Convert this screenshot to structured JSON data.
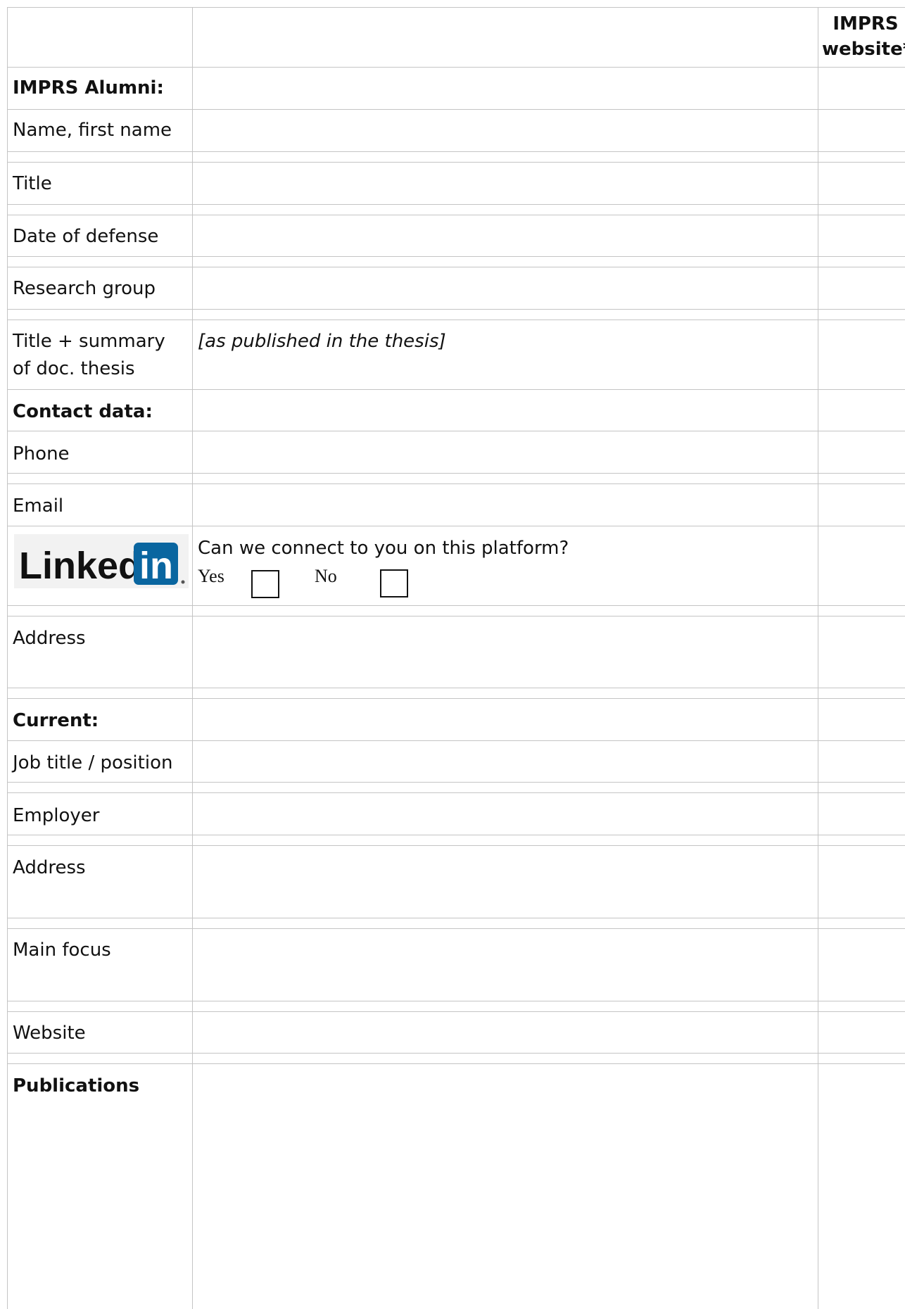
{
  "header": {
    "col3_title": [
      "IMPRS",
      "website*"
    ]
  },
  "rows": {
    "imprs_alumni": "IMPRS Alumni:",
    "name": "Name, first name",
    "title": "Title",
    "date_of_defense": "Date of defense",
    "research_group": "Research group",
    "thesis_label_1": "Title + summary",
    "thesis_label_2": "of doc. thesis",
    "thesis_hint": "[as published in the thesis]",
    "contact_data": "Contact data:",
    "phone": "Phone",
    "email": "Email",
    "linkedin_question": "Can we connect to you on this platform?",
    "yes": "Yes",
    "no": "No",
    "address": "Address",
    "current": "Current:",
    "job_title": "Job title / position",
    "employer": "Employer",
    "address2": "Address",
    "main_focus": "Main focus",
    "website": "Website",
    "publications": "Publications"
  },
  "logo": {
    "text_linked": "Linked",
    "text_in": "in",
    "brand_color": "#0a66a0",
    "icon": "linkedin-logo-icon"
  },
  "colors": {
    "grid": "#c4c4c4"
  }
}
